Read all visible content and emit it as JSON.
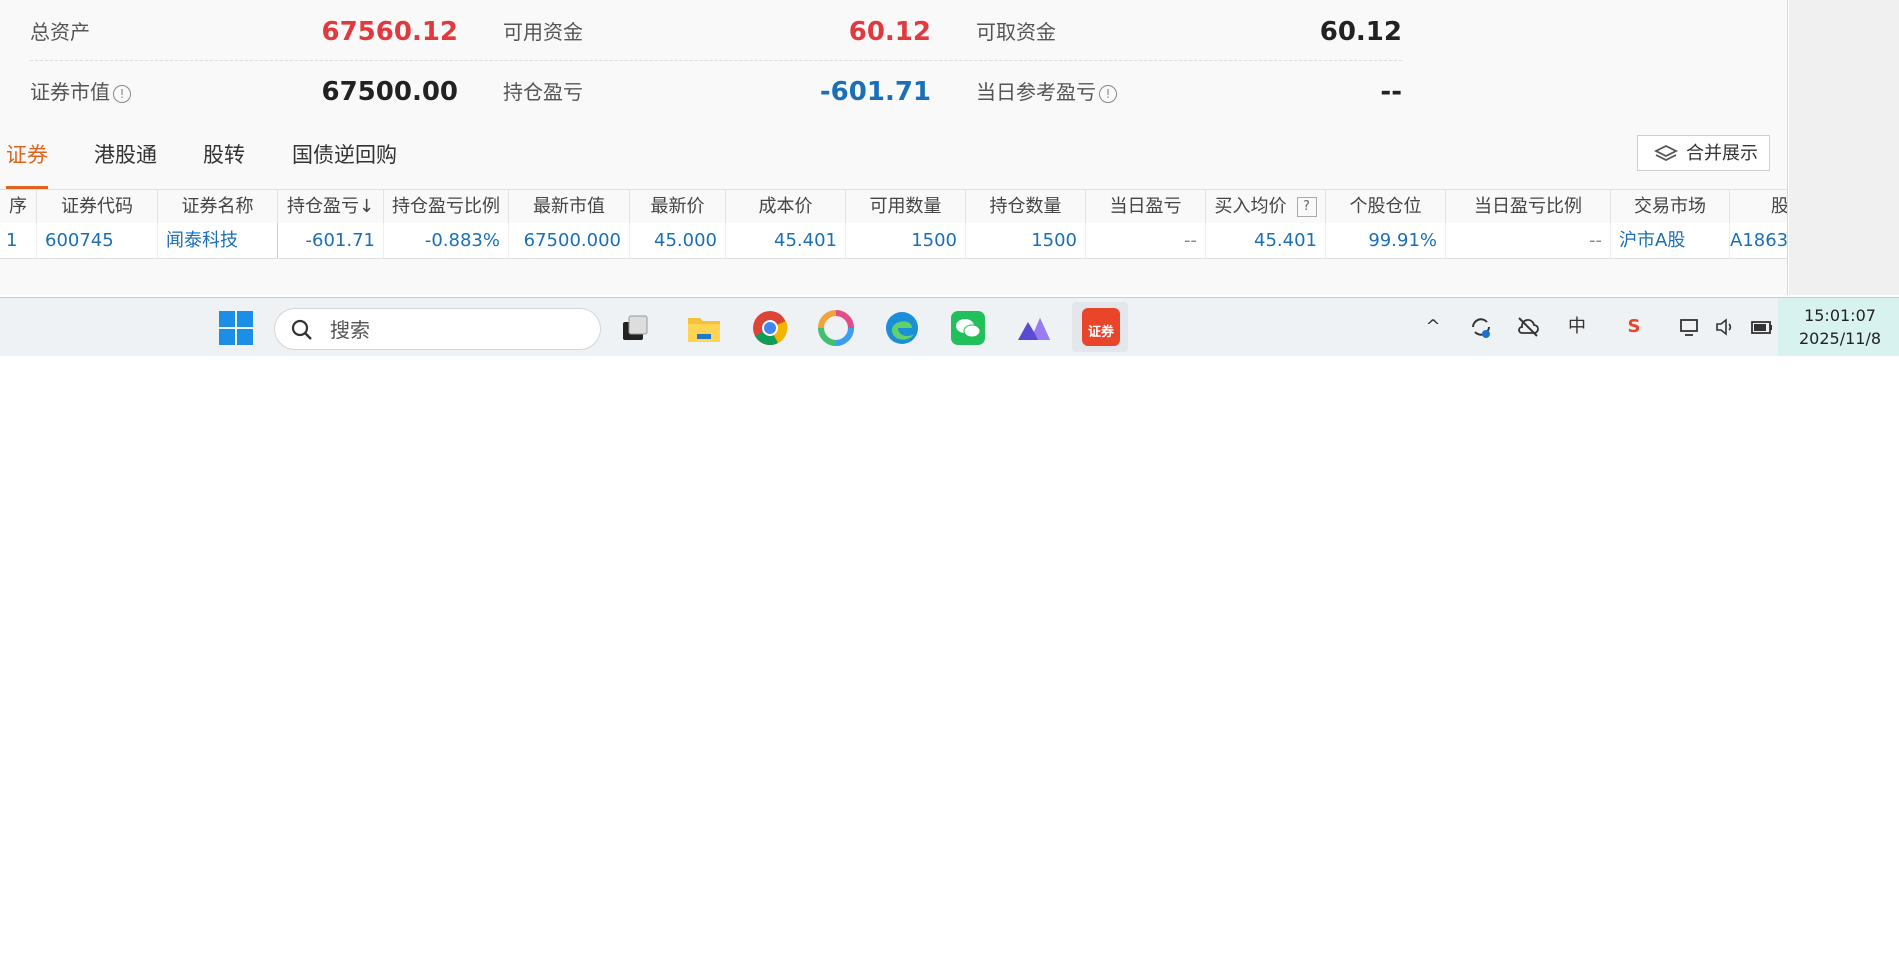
{
  "summary": {
    "total_assets_label": "总资产",
    "total_assets_value": "67560.12",
    "available_funds_label": "可用资金",
    "available_funds_value": "60.12",
    "withdrawable_funds_label": "可取资金",
    "withdrawable_funds_value": "60.12",
    "market_value_label": "证券市值",
    "market_value_value": "67500.00",
    "position_pnl_label": "持仓盈亏",
    "position_pnl_value": "-601.71",
    "daily_ref_pnl_label": "当日参考盈亏",
    "daily_ref_pnl_value": "--"
  },
  "tabs": [
    "证券",
    "港股通",
    "股转",
    "国债逆回购"
  ],
  "merge_button_label": "合并展示",
  "table": {
    "headers": [
      "序",
      "证券代码",
      "证券名称",
      "持仓盈亏",
      "持仓盈亏比例",
      "最新市值",
      "最新价",
      "成本价",
      "可用数量",
      "持仓数量",
      "当日盈亏",
      "买入均价",
      "个股仓位",
      "当日盈亏比例",
      "交易市场",
      "股东"
    ],
    "sort_indicator": "↓",
    "help_mark": "?",
    "rows": [
      [
        "1",
        "600745",
        "闻泰科技",
        "-601.71",
        "-0.883%",
        "67500.000",
        "45.000",
        "45.401",
        "1500",
        "1500",
        "--",
        "45.401",
        "99.91%",
        "--",
        "沪市A股",
        "A1863"
      ]
    ]
  },
  "taskbar": {
    "search_placeholder": "搜索",
    "tray_ime": "中",
    "clock_time": "15:01:07",
    "clock_date": "2025/11/8",
    "app_badge": "证券"
  },
  "colors": {
    "positive_red": "#e0393e",
    "negative_blue": "#1a6fb8",
    "accent_orange": "#e0641e"
  }
}
